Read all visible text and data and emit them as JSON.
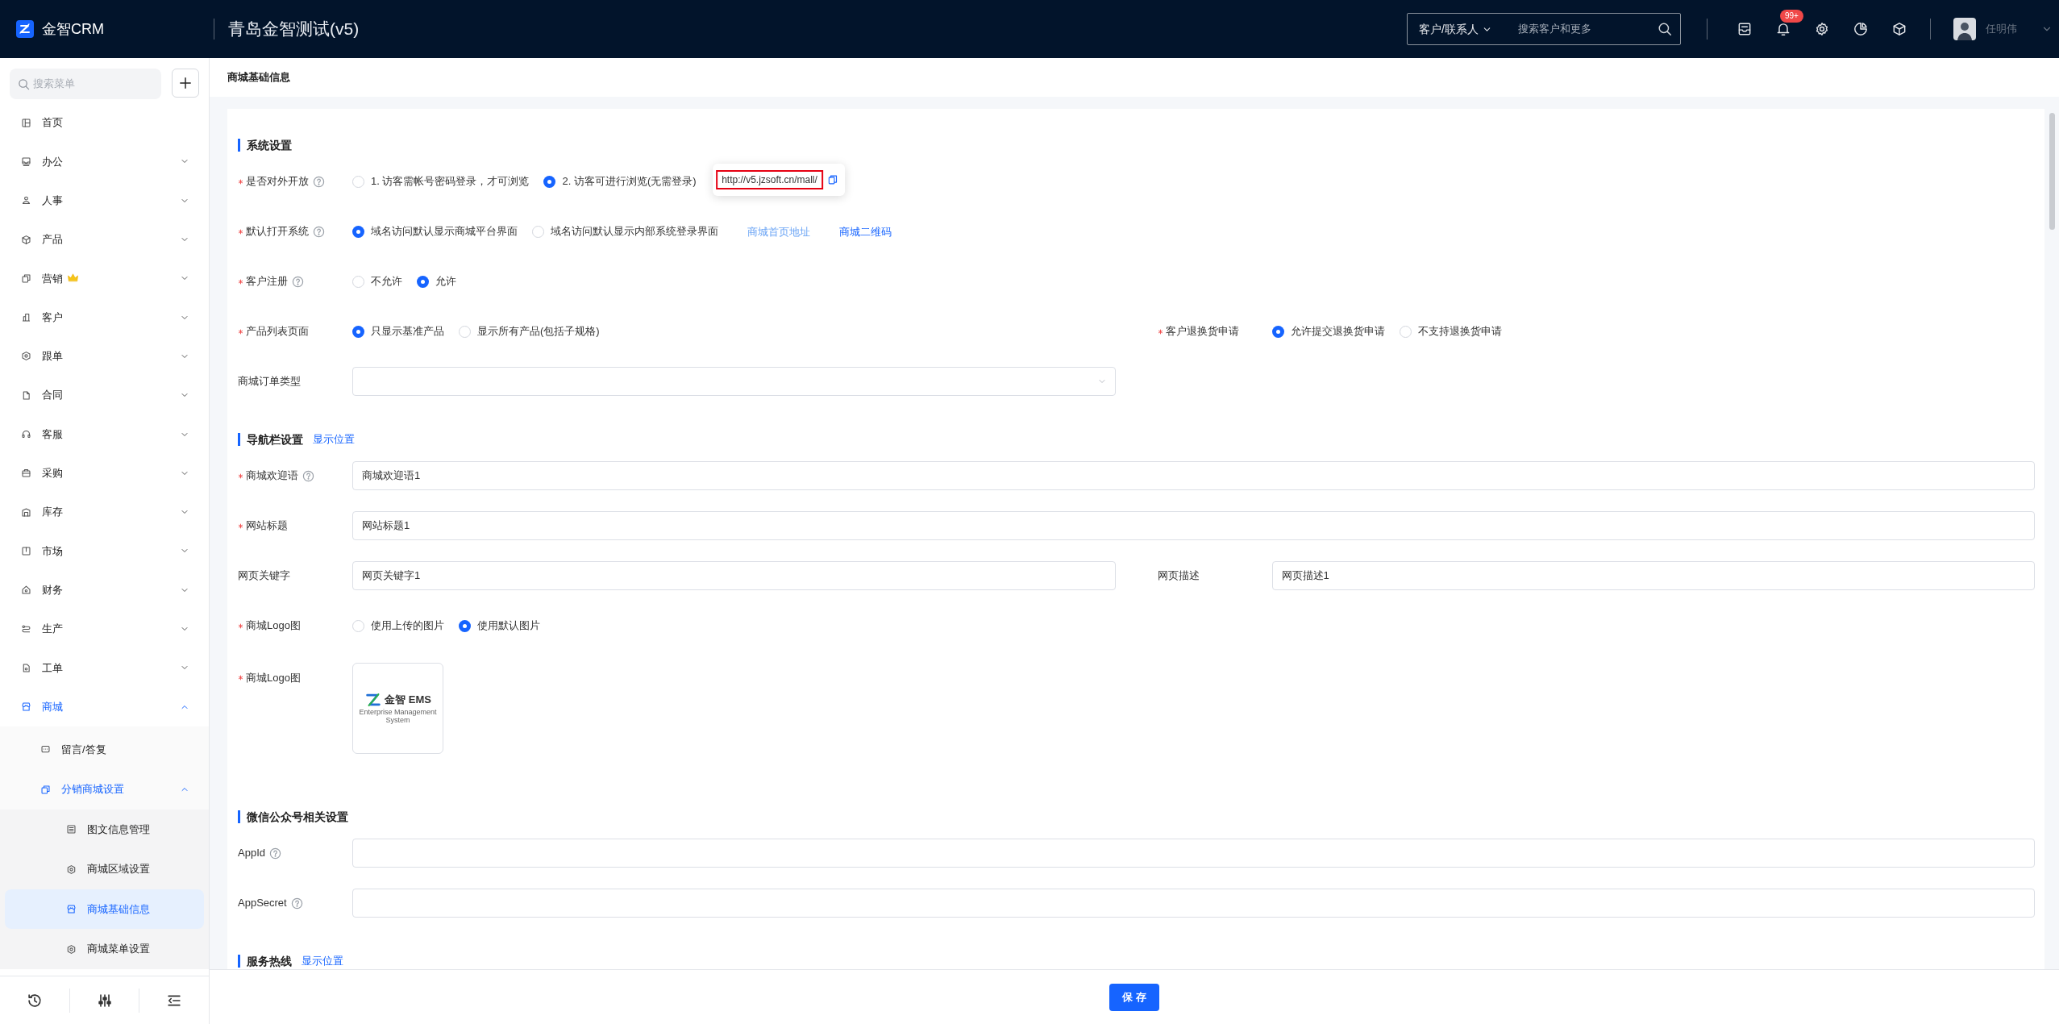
{
  "header": {
    "logo_text": "金智CRM",
    "title": "青岛金智测试(v5)",
    "search": {
      "scope": "客户/联系人",
      "placeholder": "搜索客户和更多"
    },
    "notification_count": "99+",
    "user_name": "任明伟"
  },
  "sidebar": {
    "search_placeholder": "搜索菜单",
    "items": [
      {
        "label": "首页",
        "kind": "link",
        "premium": false,
        "selected": false
      },
      {
        "label": "办公",
        "kind": "group",
        "expanded": false,
        "premium": false,
        "selected": false
      },
      {
        "label": "人事",
        "kind": "group",
        "expanded": false,
        "premium": false,
        "selected": false
      },
      {
        "label": "产品",
        "kind": "group",
        "expanded": false,
        "premium": false,
        "selected": false
      },
      {
        "label": "营销",
        "kind": "group",
        "expanded": false,
        "premium": true,
        "selected": false
      },
      {
        "label": "客户",
        "kind": "group",
        "expanded": false,
        "premium": false,
        "selected": false
      },
      {
        "label": "跟单",
        "kind": "group",
        "expanded": false,
        "premium": false,
        "selected": false
      },
      {
        "label": "合同",
        "kind": "group",
        "expanded": false,
        "premium": false,
        "selected": false
      },
      {
        "label": "客服",
        "kind": "group",
        "expanded": false,
        "premium": false,
        "selected": false
      },
      {
        "label": "采购",
        "kind": "group",
        "expanded": false,
        "premium": false,
        "selected": false
      },
      {
        "label": "库存",
        "kind": "group",
        "expanded": false,
        "premium": false,
        "selected": false
      },
      {
        "label": "市场",
        "kind": "group",
        "expanded": false,
        "premium": false,
        "selected": false
      },
      {
        "label": "财务",
        "kind": "group",
        "expanded": false,
        "premium": false,
        "selected": false
      },
      {
        "label": "生产",
        "kind": "group",
        "expanded": false,
        "premium": false,
        "selected": false
      },
      {
        "label": "工单",
        "kind": "group",
        "expanded": false,
        "premium": false,
        "selected": false
      },
      {
        "label": "商城",
        "kind": "group",
        "expanded": true,
        "premium": false,
        "selected": false,
        "children": [
          {
            "label": "留言/答复",
            "kind": "link",
            "selected": false
          },
          {
            "label": "分销商城设置",
            "kind": "group",
            "expanded": true,
            "selected": false,
            "children": [
              {
                "label": "图文信息管理",
                "kind": "link",
                "selected": false
              },
              {
                "label": "商城区域设置",
                "kind": "link",
                "selected": false
              },
              {
                "label": "商城基础信息",
                "kind": "link",
                "selected": true
              },
              {
                "label": "商城菜单设置",
                "kind": "link",
                "selected": false
              }
            ]
          }
        ]
      }
    ]
  },
  "page_title": "商城基础信息",
  "form": {
    "sections": [
      {
        "title": "系统设置",
        "rows": [
          [
            {
              "kind": "radio",
              "label": "是否对外开放",
              "required": true,
              "help": true,
              "options": [
                {
                  "label": "1. 访客需帐号密码登录，才可浏览",
                  "selected": false
                },
                {
                  "label": "2. 访客可进行浏览(无需登录)",
                  "selected": true
                }
              ]
            }
          ],
          [
            {
              "kind": "radio",
              "label": "默认打开系统",
              "required": true,
              "help": true,
              "options": [
                {
                  "label": "域名访问默认显示商城平台界面",
                  "selected": true
                },
                {
                  "label": "域名访问默认显示内部系统登录界面",
                  "selected": false
                }
              ],
              "links": [
                {
                  "label": "商城首页地址",
                  "hovered": true,
                  "popover": {
                    "url": "http://v5.jzsoft.cn/mall/",
                    "highlighted": true
                  }
                },
                {
                  "label": "商城二维码",
                  "hovered": false
                }
              ]
            }
          ],
          [
            {
              "kind": "radio",
              "label": "客户注册",
              "required": true,
              "help": true,
              "options": [
                {
                  "label": "不允许",
                  "selected": false
                },
                {
                  "label": "允许",
                  "selected": true
                }
              ]
            }
          ],
          [
            {
              "kind": "radio",
              "label": "产品列表页面",
              "required": true,
              "help": false,
              "options": [
                {
                  "label": "只显示基准产品",
                  "selected": true
                },
                {
                  "label": "显示所有产品(包括子规格)",
                  "selected": false
                }
              ]
            },
            {
              "kind": "radio",
              "label": "客户退换货申请",
              "required": true,
              "help": false,
              "options": [
                {
                  "label": "允许提交退换货申请",
                  "selected": true
                },
                {
                  "label": "不支持退换货申请",
                  "selected": false
                }
              ]
            }
          ],
          [
            {
              "kind": "select",
              "label": "商城订单类型",
              "required": false,
              "help": false
            }
          ]
        ]
      },
      {
        "title": "导航栏设置",
        "link": "显示位置",
        "rows": [
          [
            {
              "kind": "input",
              "label": "商城欢迎语",
              "required": true,
              "help": true,
              "value": "商城欢迎语1"
            }
          ],
          [
            {
              "kind": "input",
              "label": "网站标题",
              "required": true,
              "help": false,
              "value": "网站标题1"
            }
          ],
          [
            {
              "kind": "input",
              "label": "网页关键字",
              "required": false,
              "help": false,
              "value": "网页关键字1"
            },
            {
              "kind": "input",
              "label": "网页描述",
              "required": false,
              "help": false,
              "value": "网页描述1"
            }
          ],
          [
            {
              "kind": "radio",
              "label": "商城Logo图",
              "required": true,
              "help": false,
              "options": [
                {
                  "label": "使用上传的图片",
                  "selected": false
                },
                {
                  "label": "使用默认图片",
                  "selected": true
                }
              ]
            }
          ],
          [
            {
              "kind": "image",
              "label": "商城Logo图",
              "required": true,
              "help": false,
              "image": {
                "brand": "金智 EMS",
                "tagline": "Enterprise Management System"
              }
            }
          ]
        ]
      },
      {
        "title": "微信公众号相关设置",
        "rows": [
          [
            {
              "kind": "input",
              "label": "AppId",
              "required": false,
              "help": true
            }
          ],
          [
            {
              "kind": "input",
              "label": "AppSecret",
              "required": false,
              "help": true
            }
          ]
        ]
      },
      {
        "title": "服务热线",
        "link": "显示位置"
      }
    ],
    "save_button": "保 存"
  }
}
